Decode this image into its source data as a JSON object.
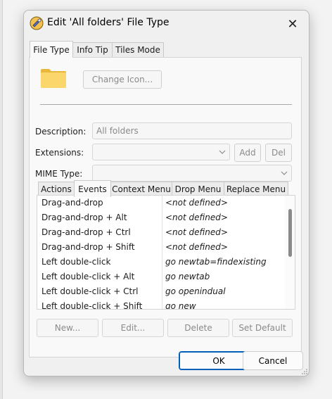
{
  "window": {
    "title": "Edit 'All folders' File Type",
    "close_glyph": "✕"
  },
  "tabs_top": [
    {
      "label": "File Type",
      "active": true
    },
    {
      "label": "Info Tip",
      "active": false
    },
    {
      "label": "Tiles Mode",
      "active": false
    }
  ],
  "file_type": {
    "folder_icon": "folder-icon",
    "folder_color": "#f8d775",
    "change_icon_label": "Change Icon...",
    "description_label": "Description:",
    "description_value": "All folders",
    "extensions_label": "Extensions:",
    "extensions_value": "",
    "add_label": "Add",
    "del_label": "Del",
    "mime_label": "MIME Type:",
    "mime_value": ""
  },
  "tabs_events": [
    {
      "label": "Actions",
      "active": false
    },
    {
      "label": "Events",
      "active": true
    },
    {
      "label": "Context Menu",
      "active": false
    },
    {
      "label": "Drop Menu",
      "active": false
    },
    {
      "label": "Replace Menu",
      "active": false
    }
  ],
  "events": [
    {
      "name": "Drag-and-drop",
      "command": "<not defined>"
    },
    {
      "name": "Drag-and-drop + Alt",
      "command": "<not defined>"
    },
    {
      "name": "Drag-and-drop + Ctrl",
      "command": "<not defined>"
    },
    {
      "name": "Drag-and-drop + Shift",
      "command": "<not defined>"
    },
    {
      "name": "Left double-click",
      "command": "go newtab=findexisting"
    },
    {
      "name": "Left double-click + Alt",
      "command": "go newtab"
    },
    {
      "name": "Left double-click + Ctrl",
      "command": "go openindual"
    },
    {
      "name": "Left double-click + Shift",
      "command": "go new"
    }
  ],
  "event_buttons": {
    "new": "New...",
    "edit": "Edit...",
    "delete": "Delete",
    "set_default": "Set Default"
  },
  "footer": {
    "ok": "OK",
    "cancel": "Cancel"
  },
  "colors": {
    "accent": "#005fb8"
  }
}
